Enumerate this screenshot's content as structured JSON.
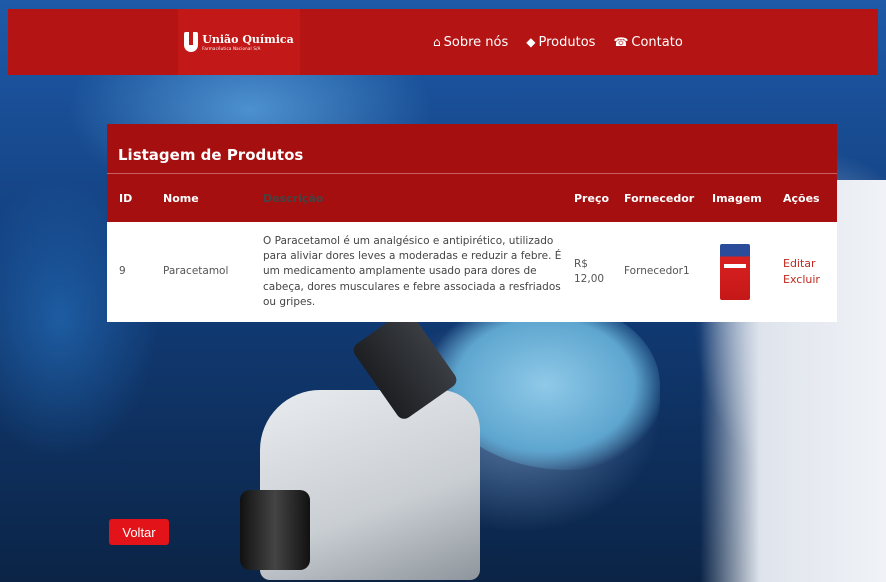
{
  "brand": {
    "name": "União Química",
    "tagline": "Farmacêutica Nacional S/A",
    "accent": "#b51414"
  },
  "nav": {
    "items": [
      {
        "label": "Sobre nós",
        "icon": "home-icon"
      },
      {
        "label": "Produtos",
        "icon": "tag-icon"
      },
      {
        "label": "Contato",
        "icon": "phone-icon"
      }
    ]
  },
  "card": {
    "title": "Listagem de Produtos",
    "columns": [
      "ID",
      "Nome",
      "Descrição",
      "Preço",
      "Fornecedor",
      "Imagem",
      "Ações"
    ],
    "rows": [
      {
        "id": "9",
        "nome": "Paracetamol",
        "descricao": "O Paracetamol é um analgésico e antipirético, utilizado para aliviar dores leves a moderadas e reduzir a febre. É um medicamento amplamente usado para dores de cabeça, dores musculares e febre associada a resfriados ou gripes.",
        "preco": "R$ 12,00",
        "fornecedor": "Fornecedor1",
        "imagem": "medicine-box-image",
        "acoes": [
          "Editar",
          "Excluir"
        ]
      }
    ]
  },
  "back_button": {
    "label": "Voltar"
  }
}
